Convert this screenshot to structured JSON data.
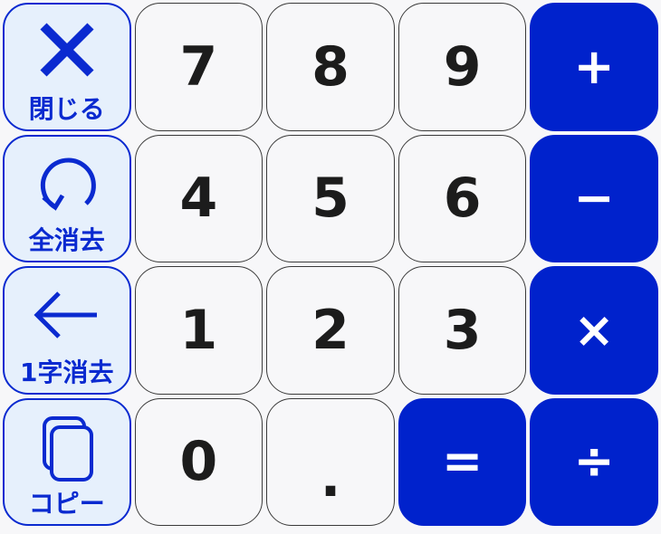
{
  "function_keys": {
    "close": {
      "label": "閉じる",
      "icon": "close-x-icon"
    },
    "clear_all": {
      "label": "全消去",
      "icon": "rotate-arrow-icon"
    },
    "backspace": {
      "label": "1字消去",
      "icon": "left-arrow-icon"
    },
    "copy": {
      "label": "コピー",
      "icon": "copy-icon"
    }
  },
  "digits": {
    "k7": "7",
    "k8": "8",
    "k9": "9",
    "k4": "4",
    "k5": "5",
    "k6": "6",
    "k1": "1",
    "k2": "2",
    "k3": "3",
    "k0": "0",
    "dot": "."
  },
  "operators": {
    "plus": "+",
    "minus": "−",
    "times": "×",
    "equals": "=",
    "divide": "÷"
  },
  "colors": {
    "accent": "#0022cc",
    "function_bg": "#e6f0fc",
    "key_bg": "#f7f7f9",
    "digit_text": "#1c1c1c"
  }
}
